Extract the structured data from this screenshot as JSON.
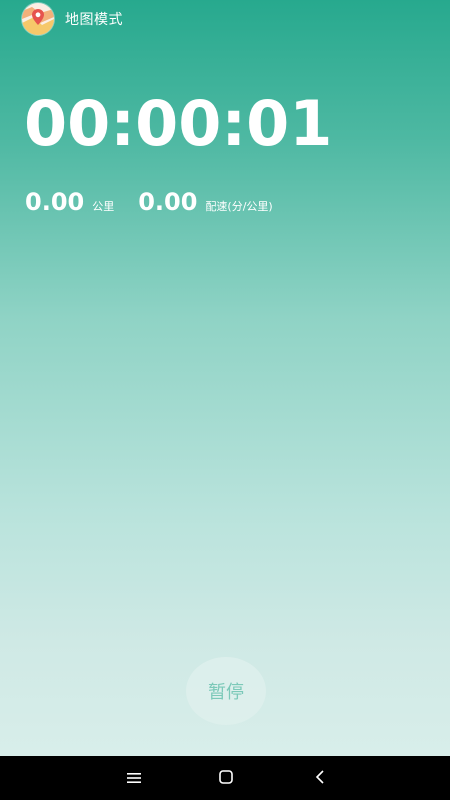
{
  "header": {
    "map_mode_label": "地图模式",
    "logo_icon": "map-pin-logo-icon"
  },
  "timer": {
    "elapsed": "00:00:01"
  },
  "stats": {
    "distance_value": "0.00",
    "distance_unit": "公里",
    "pace_value": "0.00",
    "pace_unit": "配速(分/公里)"
  },
  "controls": {
    "pause_label": "暂停"
  },
  "navbar": {
    "menu_icon": "menu-icon",
    "home_icon": "home-icon",
    "back_icon": "back-icon"
  },
  "colors": {
    "gradient_top": "#27a98e",
    "gradient_bottom": "#d8eeea",
    "pause_text": "#7cc9b9"
  }
}
